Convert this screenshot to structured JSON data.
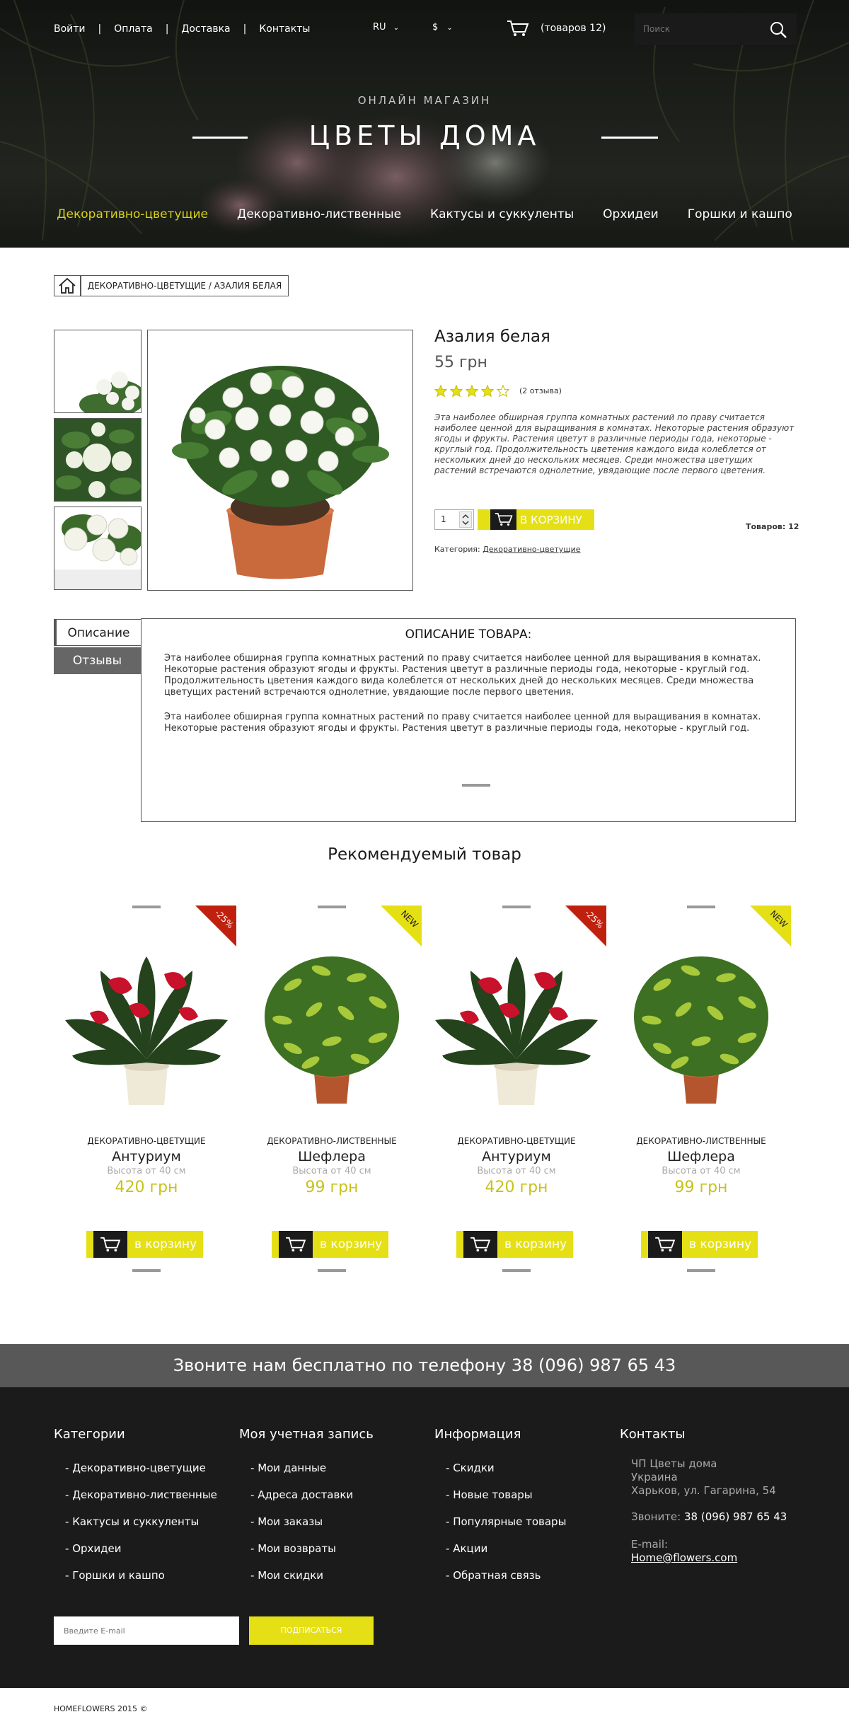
{
  "header": {
    "nav": [
      "Войти",
      "Оплата",
      "Доставка",
      "Контакты"
    ],
    "lang": "RU",
    "currency": "$",
    "cart": "(товаров 12)",
    "search_placeholder": "Поиск",
    "subtitle": "ОНЛАЙН МАГАЗИН",
    "title": "ЦВЕТЫ ДОМА",
    "categories": [
      "Декоративно-цветущие",
      "Декоративно-лиственные",
      "Кактусы и суккуленты",
      "Орхидеи",
      "Горшки и кашпо"
    ],
    "active_category": 0
  },
  "breadcrumb": "ДЕКОРАТИВНО-ЦВЕТУЩИЕ / АЗАЛИЯ БЕЛАЯ",
  "product": {
    "name": "Азалия белая",
    "price": "55 грн",
    "rating": 4,
    "reviews": "(2 отзыва)",
    "description": "Эта наиболее обширная группа комнатных растений по праву считается наиболее ценной для выращивания в комнатах. Некоторые растения образуют ягоды и фрукты. Растения цветут в различные периоды года, некоторые - круглый год. Продолжительность цветения каждого вида колеблется от нескольких дней до нескольких месяцев. Среди множества цветущих растений встречаются однолетние, увядающие после первого цветения.",
    "qty": "1",
    "add_to_cart": "В КОРЗИНУ",
    "stock": "Товаров: 12",
    "category_label": "Категория:",
    "category_value": "Декоративно-цветущие"
  },
  "tabs": {
    "items": [
      "Описание",
      "Отзывы"
    ],
    "active": 0,
    "heading": "ОПИСАНИЕ ТОВАРА:",
    "p1": "Эта наиболее обширная группа комнатных растений по праву считается наиболее ценной для выращивания в комнатах. Некоторые растения образуют ягоды и фрукты. Растения цветут в различные периоды года, некоторые - круглый год. Продолжительность цветения каждого вида колеблется от нескольких дней до нескольких месяцев. Среди множества цветущих растений встречаются однолетние, увядающие после первого цветения.",
    "p2": "Эта наиболее обширная группа комнатных растений по праву считается наиболее ценной для выращивания в комнатах. Некоторые растения образуют ягоды и фрукты. Растения цветут в различные периоды года, некоторые - круглый год."
  },
  "recommended": {
    "title": "Рекомендуемый товар",
    "items": [
      {
        "category": "ДЕКОРАТИВНО-ЦВЕТУЩИЕ",
        "name": "Антуриум",
        "height": "Высота от 40 см",
        "price": "420 грн",
        "badge": "-25%",
        "badge_color": "#c0210f",
        "plant": "anthurium",
        "cart": "в корзину"
      },
      {
        "category": "ДЕКОРАТИВНО-ЛИСТВЕННЫЕ",
        "name": "Шефлера",
        "height": "Высота от 40 см",
        "price": "99 грн",
        "badge": "NEW",
        "badge_color": "#e5e016",
        "plant": "schefflera",
        "cart": "в корзину"
      },
      {
        "category": "ДЕКОРАТИВНО-ЦВЕТУЩИЕ",
        "name": "Антуриум",
        "height": "Высота от 40 см",
        "price": "420 грн",
        "badge": "-25%",
        "badge_color": "#c0210f",
        "plant": "anthurium",
        "cart": "в корзину"
      },
      {
        "category": "ДЕКОРАТИВНО-ЛИСТВЕННЫЕ",
        "name": "Шефлера",
        "height": "Высота от 40 см",
        "price": "99 грн",
        "badge": "NEW",
        "badge_color": "#e5e016",
        "plant": "schefflera",
        "cart": "в корзину"
      }
    ]
  },
  "phone_banner": "Звоните нам бесплатно по телефону 38 (096) 987 65 43",
  "footer": {
    "categories": {
      "title": "Категории",
      "items": [
        "Декоративно-цветущие",
        "Декоративно-лиственные",
        "Кактусы и суккуленты",
        "Орхидеи",
        "Горшки и кашпо"
      ]
    },
    "account": {
      "title": "Моя учетная запись",
      "items": [
        "Мои данные",
        "Адреса доставки",
        "Мои заказы",
        "Мои возвраты",
        "Мои скидки"
      ]
    },
    "info": {
      "title": "Информация",
      "items": [
        "Скидки",
        "Новые товары",
        "Популярные товары",
        "Акции",
        "Обратная связь"
      ]
    },
    "contacts": {
      "title": "Контакты",
      "company": "ЧП Цветы дома",
      "country": "Украина",
      "address": "Харьков, ул. Гагарина, 54",
      "phone_label": "Звоните:",
      "phone": "38 (096) 987 65 43",
      "email_label": "E-mail:",
      "email": "Home@flowers.com"
    },
    "email_placeholder": "Введите E-mail",
    "subscribe": "ПОДПИСАТЬСЯ",
    "copyright": "HOMEFLOWERS 2015 ©"
  },
  "colors": {
    "accent": "#e5e016",
    "dark": "#1b1b1b",
    "banner": "#585858",
    "sale": "#c0210f"
  }
}
